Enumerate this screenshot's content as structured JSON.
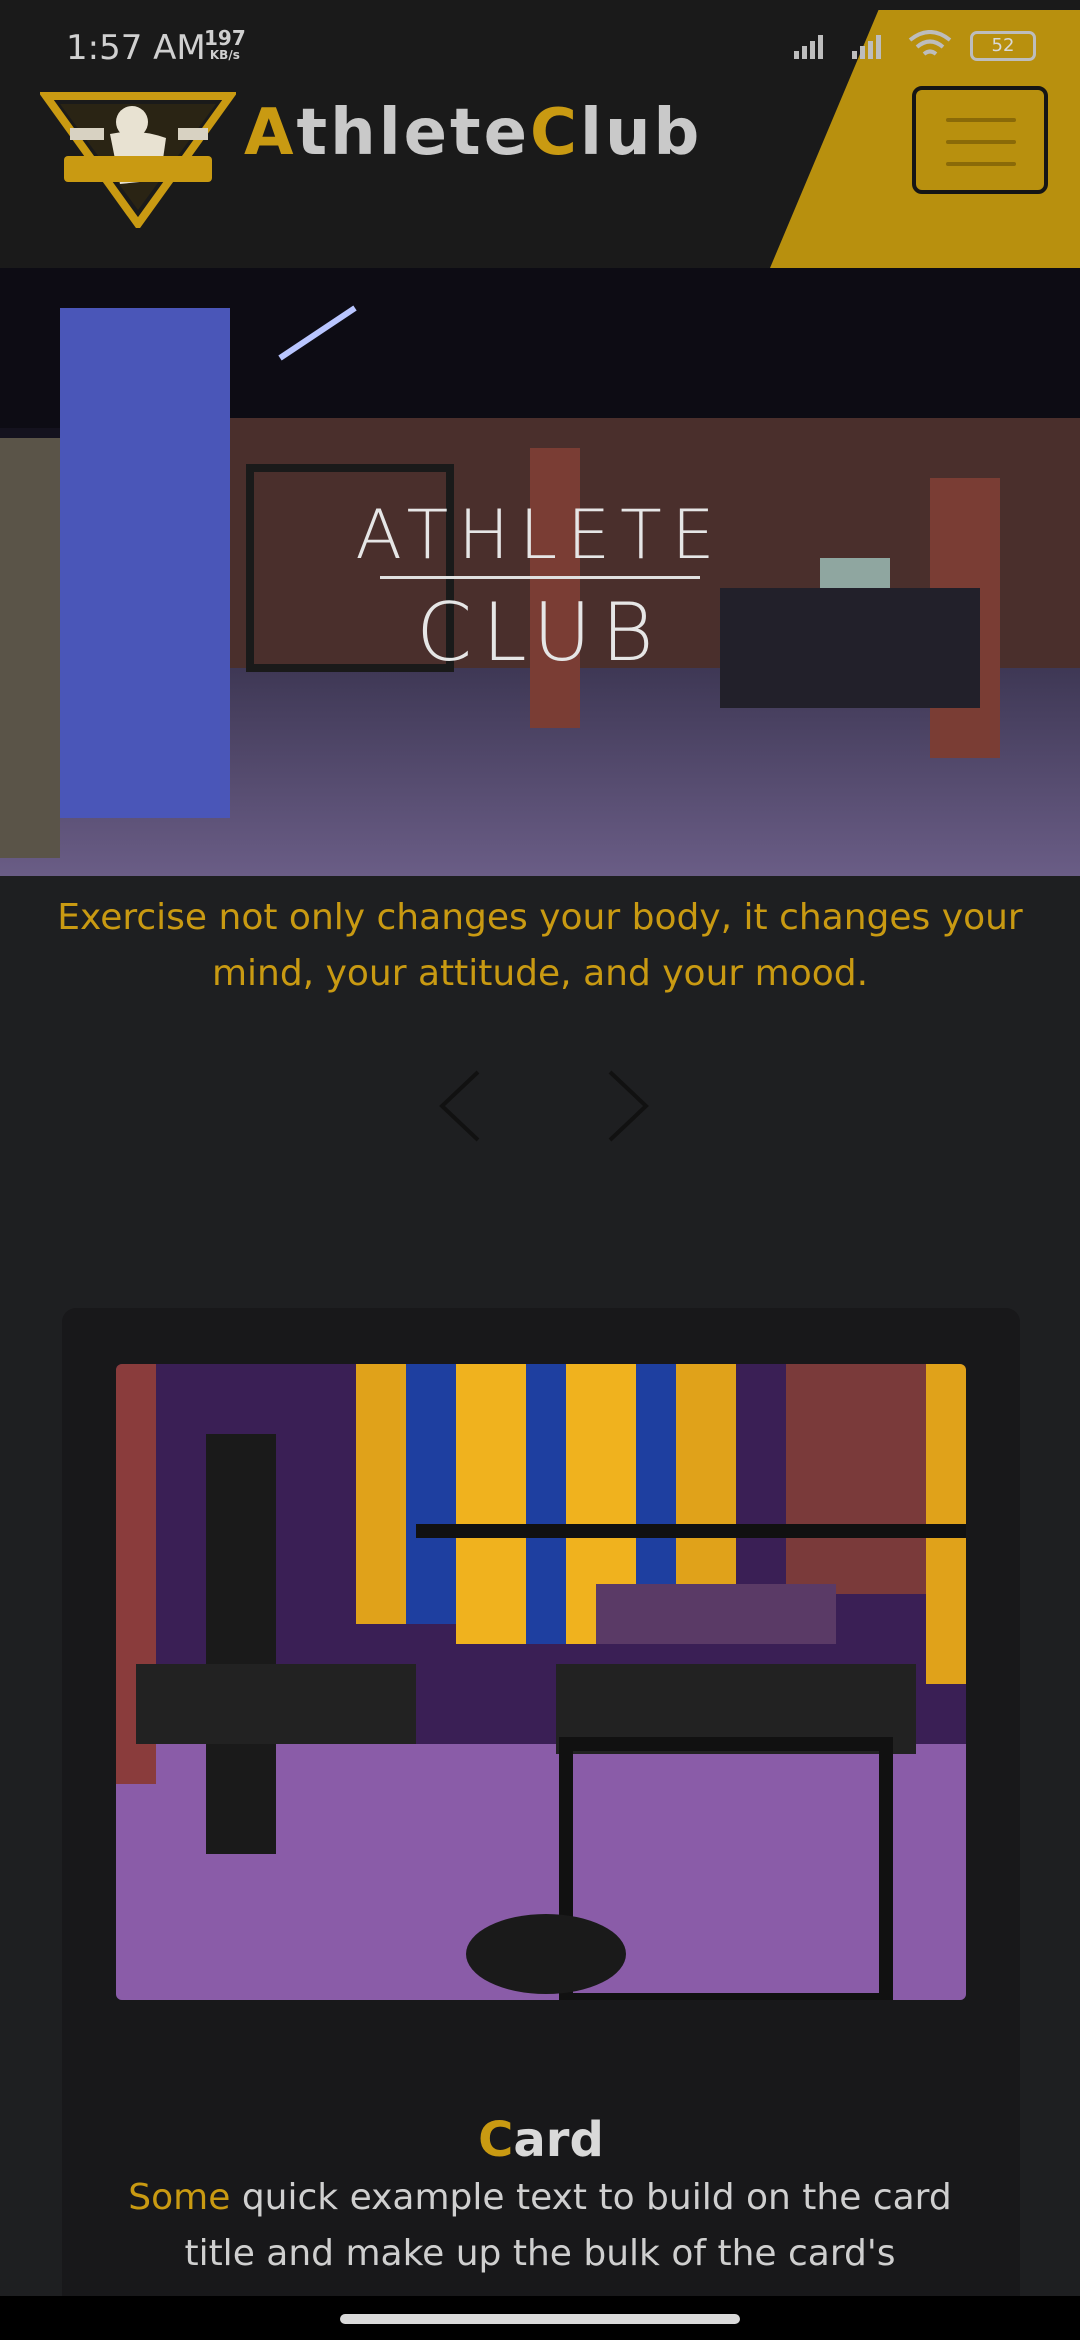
{
  "status_bar": {
    "time": "1:57 AM",
    "speed_value": "197",
    "speed_unit": "KB/s",
    "battery": "52"
  },
  "header": {
    "brand_first_letter": "A",
    "brand_part1": "thlete",
    "brand_second_letter": "C",
    "brand_part2": "lub",
    "logo_badge_text": "ATHLETE CLUB",
    "menu_icon": "hamburger-icon"
  },
  "hero": {
    "title_line1": "ATHLETE",
    "title_line2": "CLUB",
    "quote": "Exercise not only changes your body, it changes your mind, your attitude, and your mood."
  },
  "carousel": {
    "prev_icon": "chevron-left-icon",
    "next_icon": "chevron-right-icon"
  },
  "card": {
    "title_first_letter": "C",
    "title_rest": "ard",
    "text_first_word": "Some",
    "text_rest": " quick example text to build on the card title and make up the bulk of the card's"
  },
  "colors": {
    "accent": "#c99a12",
    "header_accent": "#b8900e",
    "background": "#1e1f21",
    "card_bg": "#18181a"
  }
}
